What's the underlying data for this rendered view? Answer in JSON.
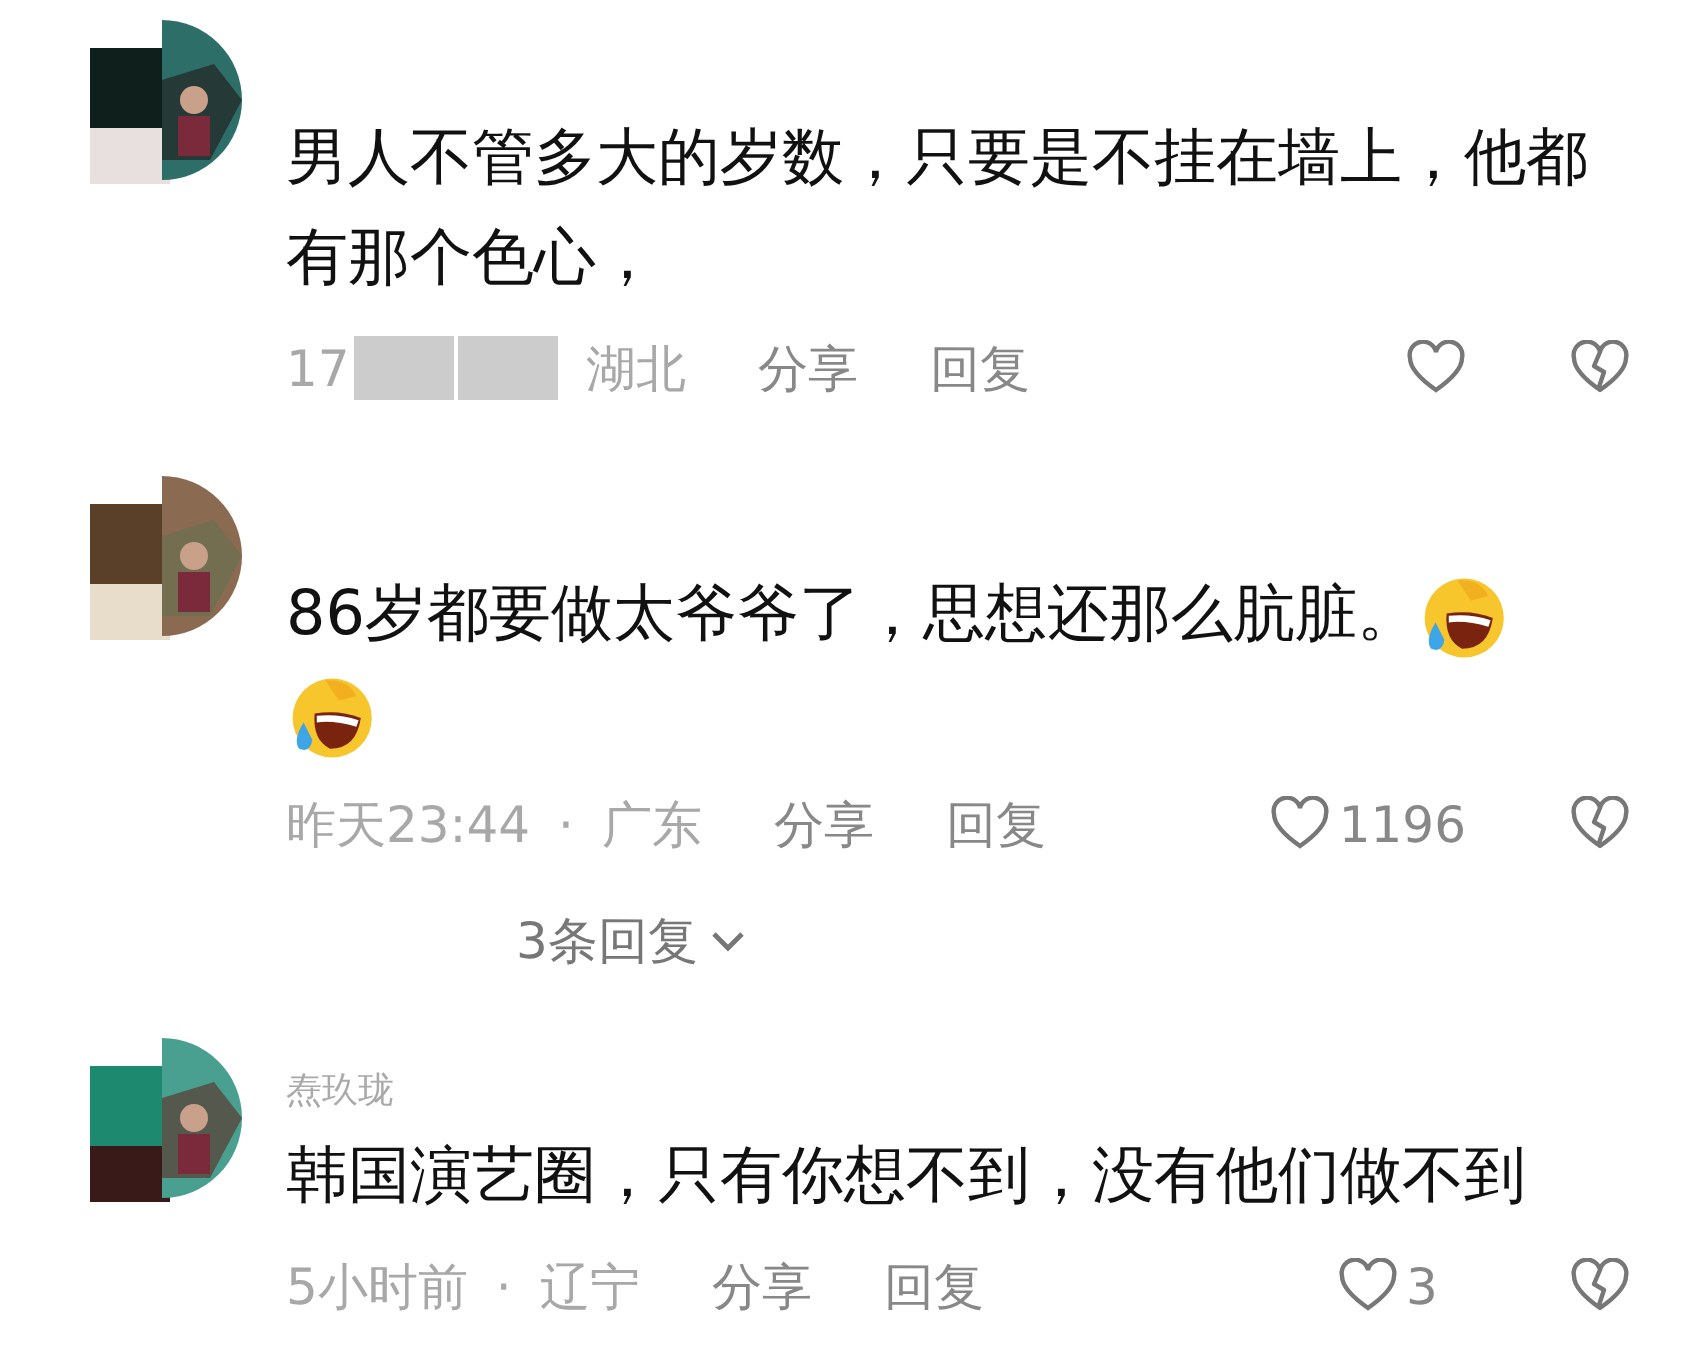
{
  "comments": [
    {
      "content": [
        {
          "kind": "text",
          "text": "男人不管多大的岁数，只要是不挂在墙上，他都有那个色心，"
        }
      ],
      "time": "17",
      "time_redacted": true,
      "location": "湖北",
      "actions": [
        "分享",
        "回复"
      ]
    },
    {
      "content": [
        {
          "kind": "text",
          "text": "86岁都要做太爷爷了，思想还那么肮脏。"
        },
        {
          "kind": "emoji"
        },
        {
          "kind": "emoji"
        }
      ],
      "time": "昨天23:44",
      "separator": "·",
      "location": "广东",
      "actions": [
        "分享",
        "回复"
      ],
      "like_count": "1196",
      "replies": "3条回复"
    },
    {
      "author": "焘玖珑",
      "content": [
        {
          "kind": "text",
          "text": "韩国演艺圈，只有你想不到，没有他们做不到"
        }
      ],
      "time": "5小时前",
      "separator": "·",
      "location": "辽宁",
      "actions": [
        "分享",
        "回复"
      ],
      "like_count": "3"
    }
  ]
}
